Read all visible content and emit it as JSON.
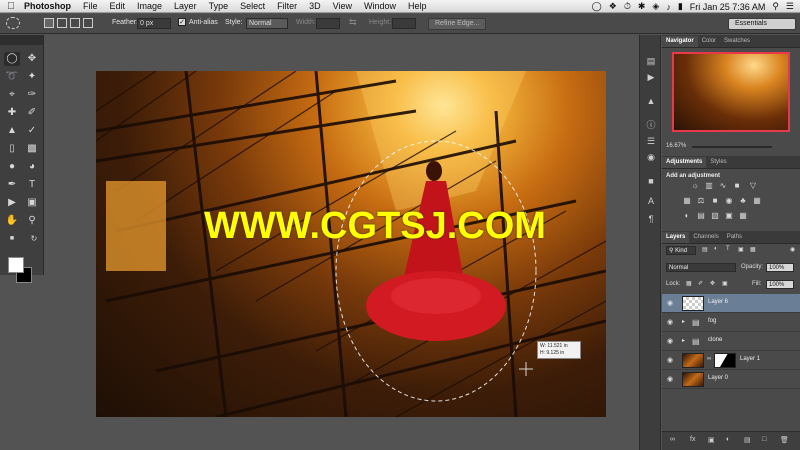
{
  "menubar": {
    "app_name": "Photoshop",
    "items": [
      "File",
      "Edit",
      "Image",
      "Layer",
      "Type",
      "Select",
      "Filter",
      "3D",
      "View",
      "Window",
      "Help"
    ],
    "clock": "Fri Jan 25  7:36 AM"
  },
  "options": {
    "feather_label": "Feather:",
    "feather_value": "0 px",
    "antialias_label": "Anti-alias",
    "style_label": "Style:",
    "style_value": "Normal",
    "width_label": "Width:",
    "height_label": "Height:",
    "refine_edge": "Refine Edge...",
    "workspace": "Essentials"
  },
  "canvas": {
    "watermark": "WWW.CGTSJ.COM",
    "info_w": "W: 11.521 in",
    "info_h": "H:  9.125 in"
  },
  "panels": {
    "nav_tabs": [
      "Navigator",
      "Color",
      "Swatches"
    ],
    "zoom": "16.67%",
    "adj_tabs": [
      "Adjustments",
      "Styles"
    ],
    "adj_title": "Add an adjustment",
    "layer_tabs": [
      "Layers",
      "Channels",
      "Paths"
    ],
    "kind_label": "Kind",
    "blend_mode": "Normal",
    "opacity_label": "Opacity:",
    "opacity_value": "100%",
    "lock_label": "Lock:",
    "fill_label": "Fill:",
    "fill_value": "100%",
    "layers": [
      {
        "name": "Layer 6",
        "selected": true
      },
      {
        "name": "fog",
        "selected": false
      },
      {
        "name": "clone",
        "selected": false
      },
      {
        "name": "Layer 1",
        "selected": false
      },
      {
        "name": "Layer 0",
        "selected": false
      }
    ]
  }
}
